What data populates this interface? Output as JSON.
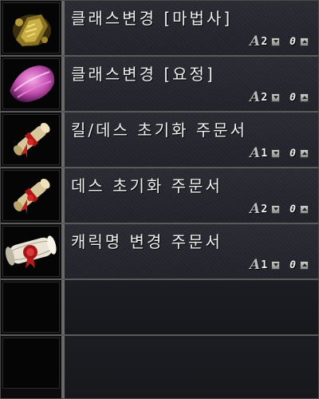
{
  "items": [
    {
      "name": "클래스변경 [마법사]",
      "count": "2",
      "zero": "0",
      "icon": "gold-book-icon"
    },
    {
      "name": "클래스변경 [요정]",
      "count": "2",
      "zero": "0",
      "icon": "pink-feather-icon"
    },
    {
      "name": "킬/데스 초기화 주문서",
      "count": "1",
      "zero": "0",
      "icon": "scroll-red-ribbon-icon"
    },
    {
      "name": "데스 초기화 주문서",
      "count": "2",
      "zero": "0",
      "icon": "scroll-red-ribbon-icon"
    },
    {
      "name": "캐릭명 변경 주문서",
      "count": "1",
      "zero": "0",
      "icon": "scroll-red-seal-icon"
    }
  ],
  "empty_slots": 2,
  "colors": {
    "row_bg": "#2a2b33",
    "separator": "#6a6a6a",
    "text": "#f0f0f0"
  }
}
